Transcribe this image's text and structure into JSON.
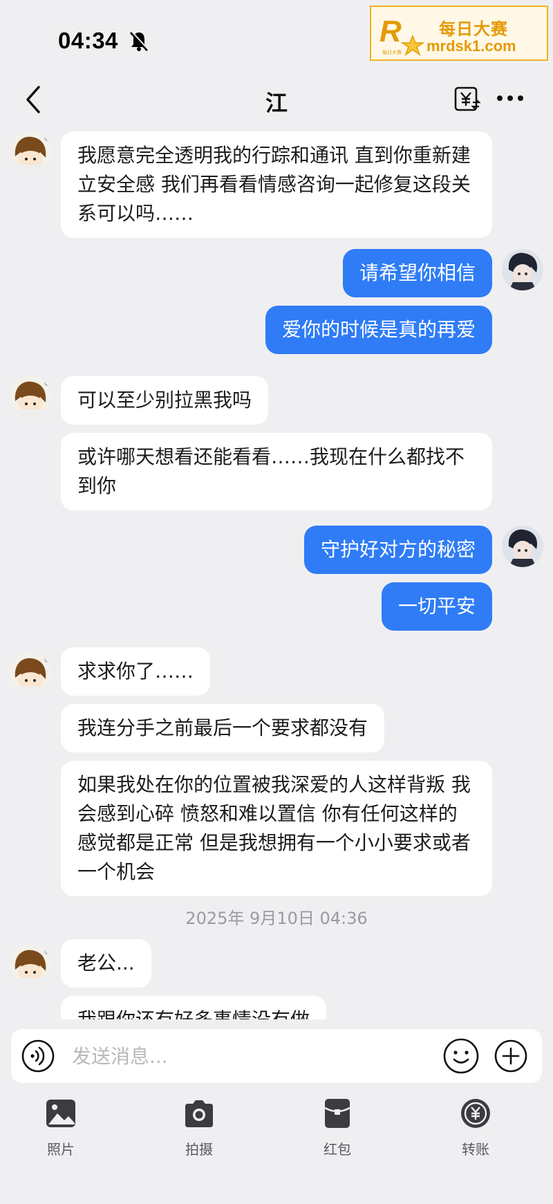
{
  "status_bar": {
    "time": "04:34"
  },
  "watermark": {
    "line1": "每日大赛",
    "line2": "mrdsk1.com",
    "logo_small": "每日大赛"
  },
  "header": {
    "title": "江"
  },
  "messages": [
    {
      "side": "in",
      "text": "我愿意完全透明我的行踪和通讯 直到你重新建立安全感 我们再看看情感咨询一起修复这段关系可以吗……"
    },
    {
      "side": "out",
      "text": "请希望你相信"
    },
    {
      "side": "out",
      "text": "爱你的时候是真的再爱"
    },
    {
      "side": "in",
      "text": "可以至少别拉黑我吗"
    },
    {
      "side": "in",
      "text": "或许哪天想看还能看看……我现在什么都找不到你"
    },
    {
      "side": "out",
      "text": "守护好对方的秘密"
    },
    {
      "side": "out",
      "text": "一切平安"
    },
    {
      "side": "in",
      "text": "求求你了……"
    },
    {
      "side": "in",
      "text": "我连分手之前最后一个要求都没有"
    },
    {
      "side": "in",
      "text": "如果我处在你的位置被我深爱的人这样背叛 我会感到心碎 愤怒和难以置信 你有任何这样的感觉都是正常 但是我想拥有一个小小要求或者一个机会"
    },
    {
      "side": "in",
      "text": "老公..."
    },
    {
      "side": "in",
      "text": "我跟你还有好多事情没有做"
    }
  ],
  "timestamp": "2025年 9月10日 04:36",
  "input": {
    "placeholder": "发送消息..."
  },
  "toolbar": {
    "photo": "照片",
    "camera": "拍摄",
    "red_packet": "红包",
    "transfer": "转账"
  },
  "colors": {
    "accent": "#2f7cf6",
    "background": "#efeff1",
    "bubble_in": "#ffffff",
    "watermark": "#e49a05"
  },
  "icons": [
    "bell-off-icon",
    "back-icon",
    "yuan-transfer-icon",
    "more-icon",
    "voice-icon",
    "emoji-icon",
    "plus-icon",
    "photo-icon",
    "camera-icon",
    "red-packet-icon",
    "transfer-icon"
  ]
}
